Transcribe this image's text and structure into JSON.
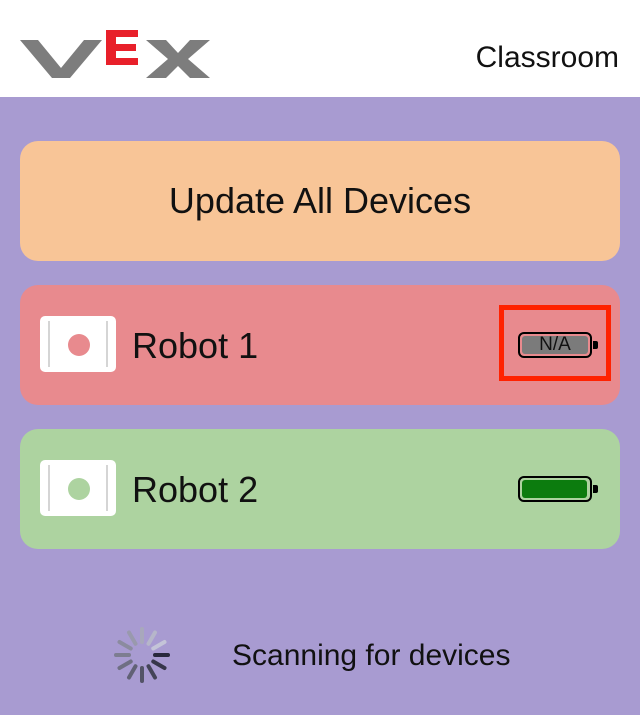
{
  "header": {
    "logo_text": "VEX",
    "title": "Classroom"
  },
  "update_button": {
    "label": "Update All Devices"
  },
  "robots": [
    {
      "name": "Robot 1",
      "status_color": "#e88a8e",
      "battery_label": "N/A",
      "battery_level": null,
      "highlighted": true
    },
    {
      "name": "Robot 2",
      "status_color": "#add3a0",
      "battery_label": "",
      "battery_level": 1.0,
      "highlighted": false
    }
  ],
  "scanning": {
    "text": "Scanning for devices",
    "icon": "spinner-icon"
  },
  "colors": {
    "background": "#a89bd1",
    "update_button": "#f8c597",
    "robot_1": "#e88a8e",
    "robot_2": "#add3a0",
    "logo_grey": "#7d7d7d",
    "logo_red": "#e8202a",
    "battery_full": "#0c7c0e",
    "battery_na": "#7b7b7b",
    "highlight": "#ff2200"
  }
}
